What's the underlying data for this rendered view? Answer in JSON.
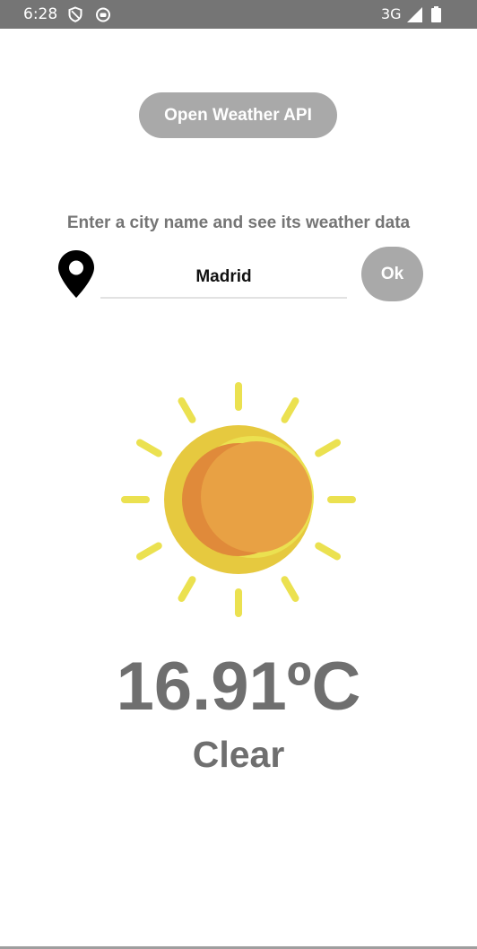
{
  "status_bar": {
    "time": "6:28",
    "network": "3G",
    "icons": [
      "shield-icon",
      "sim-icon",
      "signal-icon",
      "battery-icon"
    ]
  },
  "header": {
    "api_button_label": "Open Weather API"
  },
  "search": {
    "prompt": "Enter a city name and see its weather data",
    "city_value": "Madrid",
    "ok_label": "Ok",
    "icon": "location-pin-icon"
  },
  "weather": {
    "icon": "sun-icon",
    "temperature": "16.91ºC",
    "description": "Clear"
  },
  "colors": {
    "status_bar": "#757575",
    "button": "#a9a9a9",
    "text": "#6f6f6f",
    "sun_rays": "#ebe150",
    "sun_outer": "#e8d44a",
    "sun_inner": "#e8a040"
  }
}
